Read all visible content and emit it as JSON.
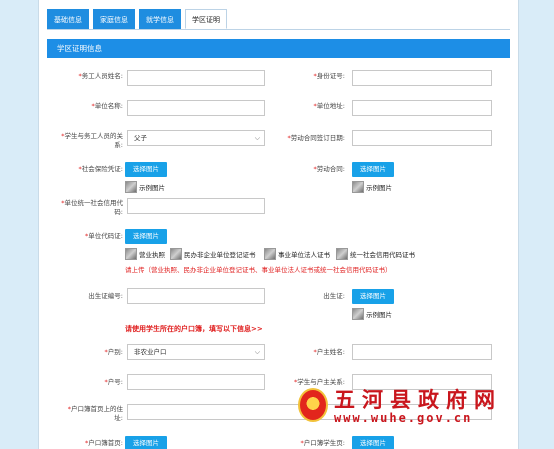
{
  "tabs": [
    "基础信息",
    "家庭信息",
    "就学信息",
    "学区证明"
  ],
  "section_title": "学区证明信息",
  "fields": {
    "worker_name": "*务工人员姓名:",
    "id_number": "*身份证号:",
    "unit_name": "*单位名称:",
    "unit_address": "*单位地址:",
    "relation_label_1": "*学生与务工人员的关",
    "relation_label_2": "系:",
    "relation_value": "父子",
    "contract_date": "*劳动合同签订日期:",
    "social_security": "*社会保险凭证:",
    "labor_contract": "*劳动合同:",
    "credit_code_1": "*单位统一社会信用代",
    "credit_code_2": "码:",
    "unit_cert": "*单位代码证:",
    "birth_cert_no": "出生证编号:",
    "birth_cert": "出生证:",
    "hukou_type": "*户别:",
    "hukou_type_value": "非农业户口",
    "householder_name": "*户主姓名:",
    "hukou_no": "*户号:",
    "relation_householder": "*学生与户主关系:",
    "address_1": "*户口簿首页上的住",
    "address_2": "址:",
    "hukou_first_page": "*户口簿首页:",
    "hukou_student_page": "*户口簿学生页:"
  },
  "buttons": {
    "select_image": "选择图片"
  },
  "samples": {
    "sample_image": "示例图片",
    "business_license": "营业执照",
    "private_nonenterprise": "民办非企业单位登记证书",
    "public_institution": "事业单位法人证书",
    "unified_credit": "统一社会信用代码证书"
  },
  "notes": {
    "upload_note": "请上传（营业执照、民办非企业单位登记证书、事业单位法人证书或统一社会信用代码证书）",
    "hukou_note": "请使用学生所在的户口簿，填写以下信息>>"
  },
  "watermark": {
    "title": "五河县政府网",
    "url": "www.wuhe.gov.cn"
  }
}
